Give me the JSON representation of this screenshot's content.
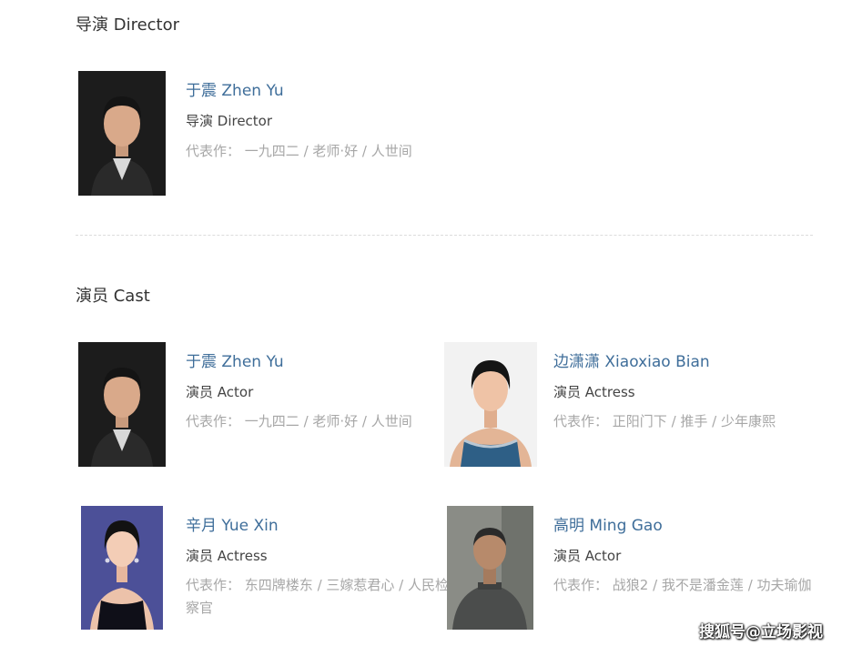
{
  "director_section": {
    "title": "导演 Director",
    "people": [
      {
        "name": "于震 Zhen Yu",
        "role": "导演 Director",
        "works_label": "代表作：",
        "works": "一九四二 / 老师·好 / 人世间",
        "photo_icon": "portrait-man-dark-background"
      }
    ]
  },
  "cast_section": {
    "title": "演员 Cast",
    "people": [
      {
        "name": "于震 Zhen Yu",
        "role": "演员 Actor",
        "works_label": "代表作：",
        "works": "一九四二 / 老师·好 / 人世间",
        "photo_icon": "portrait-man-dark-background"
      },
      {
        "name": "边潇潇 Xiaoxiao Bian",
        "role": "演员 Actress",
        "works_label": "代表作：",
        "works": "正阳门下 / 推手 / 少年康熙",
        "photo_icon": "portrait-woman-light-background"
      },
      {
        "name": "辛月 Yue Xin",
        "role": "演员 Actress",
        "works_label": "代表作：",
        "works": "东四牌楼东 / 三嫁惹君心 / 人民检察官",
        "photo_icon": "portrait-woman-blue-background"
      },
      {
        "name": "高明 Ming Gao",
        "role": "演员 Actor",
        "works_label": "代表作：",
        "works": "战狼2 / 我不是潘金莲 / 功夫瑜伽",
        "photo_icon": "portrait-man-grey-tunic"
      }
    ]
  },
  "watermark": "搜狐号@立场影视",
  "colors": {
    "name_link": "#3f6e9a",
    "muted_text": "#a7a7a7",
    "role_text": "#444444"
  }
}
